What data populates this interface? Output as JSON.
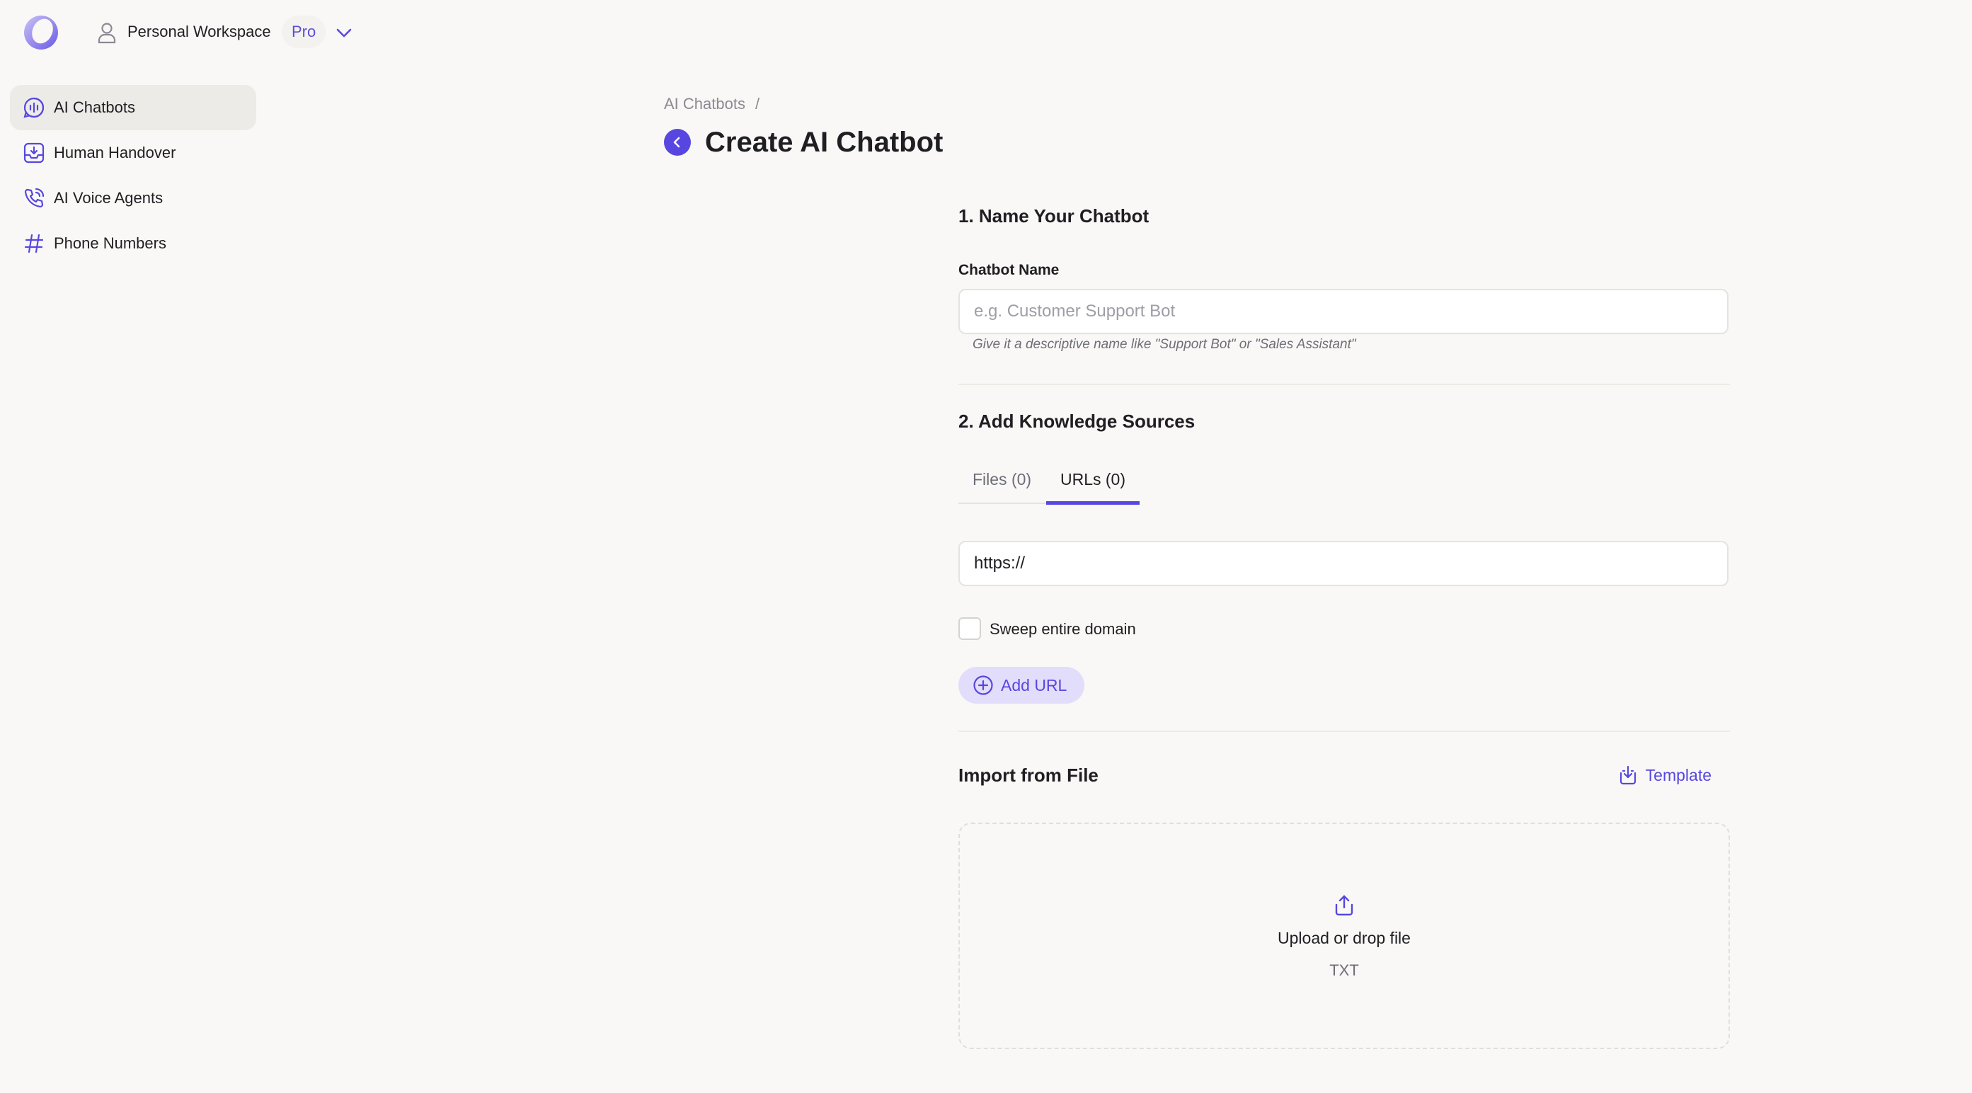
{
  "topbar": {
    "workspace_name": "Personal Workspace",
    "plan_badge": "Pro",
    "logo_icon": "app-logo",
    "user_icon": "user-icon",
    "chevron_icon": "chevron-down-icon"
  },
  "sidebar": {
    "items": [
      {
        "label": "AI Chatbots",
        "icon": "chatbot-icon",
        "active": true
      },
      {
        "label": "Human Handover",
        "icon": "inbox-download-icon",
        "active": false
      },
      {
        "label": "AI Voice Agents",
        "icon": "phone-call-icon",
        "active": false
      },
      {
        "label": "Phone Numbers",
        "icon": "hash-icon",
        "active": false
      }
    ]
  },
  "header": {
    "breadcrumb": [
      "AI Chatbots"
    ],
    "breadcrumb_sep": "/",
    "title": "Create AI Chatbot",
    "back_icon": "chevron-left-icon"
  },
  "form": {
    "section1_title": "1. Name Your Chatbot",
    "name_label": "Chatbot Name",
    "name_value": "",
    "name_placeholder": "e.g. Customer Support Bot",
    "name_hint": "Give it a descriptive name like \"Support Bot\" or \"Sales Assistant\"",
    "section2_title": "2. Add Knowledge Sources",
    "tabs": [
      {
        "label": "Files (0)",
        "active": false
      },
      {
        "label": "URLs (0)",
        "active": true
      }
    ],
    "url_value": "https://",
    "sweep_label": "Sweep entire domain",
    "sweep_checked": false,
    "add_url_label": "Add URL",
    "import_title": "Import from File",
    "template_label": "Template",
    "upload_title": "Upload or drop file",
    "upload_types": "TXT"
  },
  "colors": {
    "accent": "#5747e0",
    "background": "#f9f8f6",
    "active_nav": "#ecebe7",
    "add_url_bg": "#e2ddfa"
  }
}
